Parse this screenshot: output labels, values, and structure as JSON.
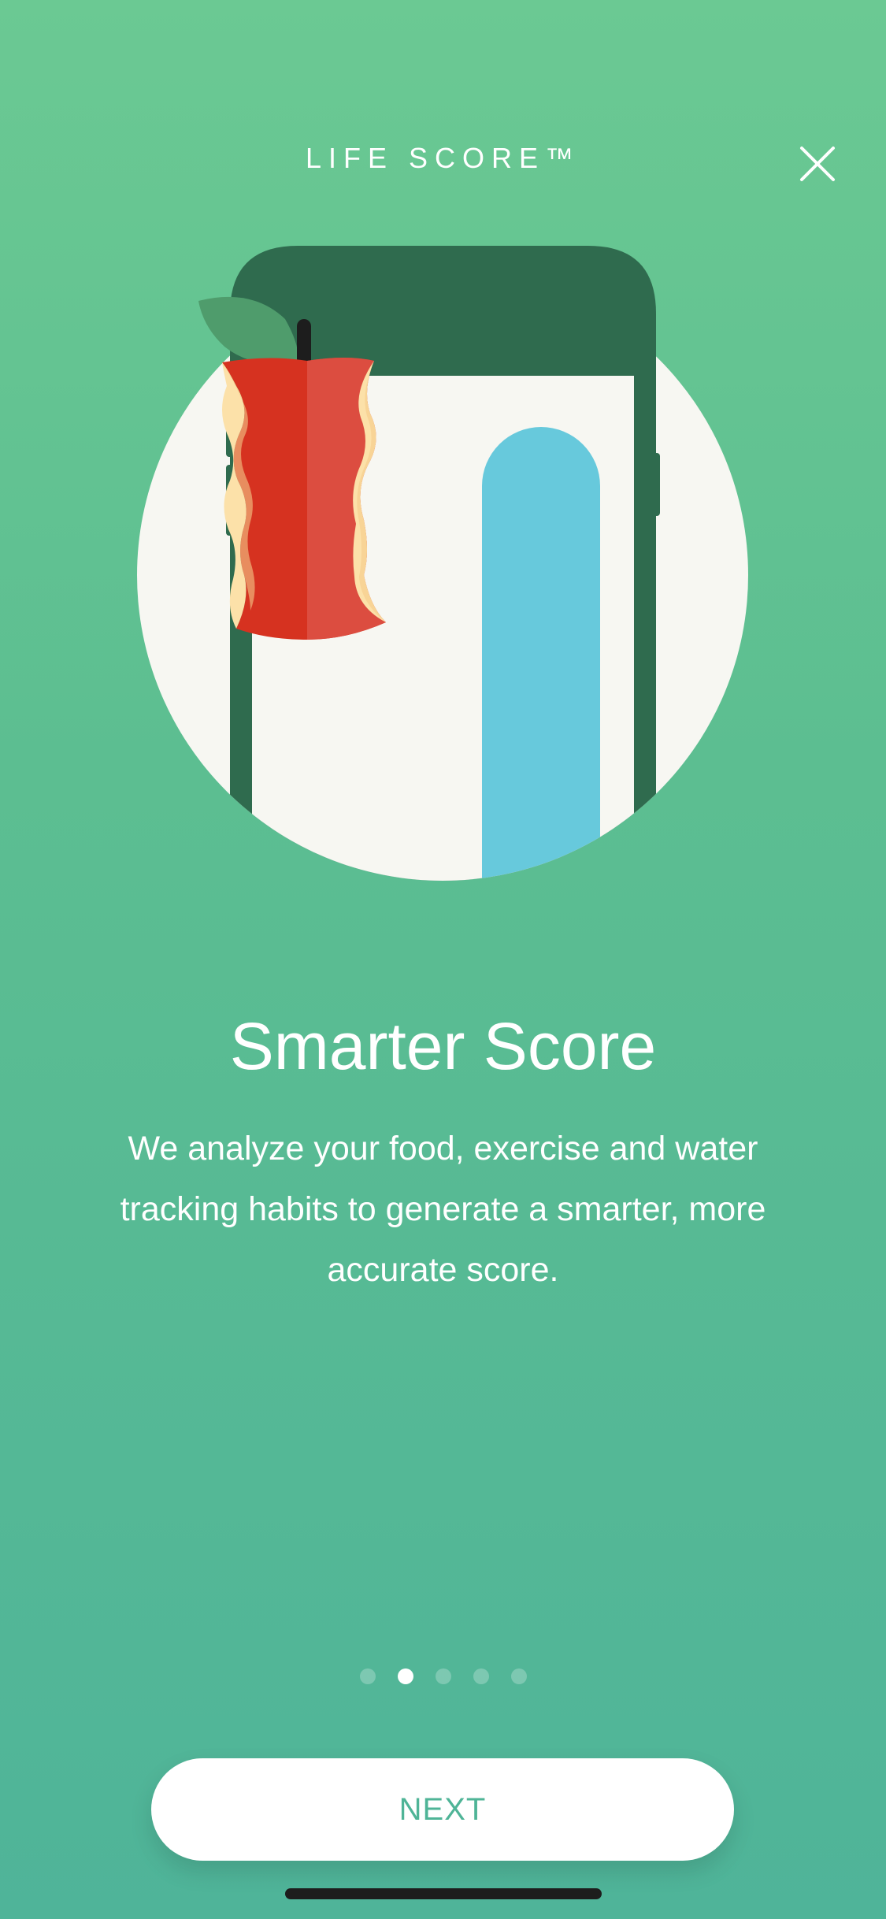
{
  "header": {
    "title": "LIFE SCORE™",
    "close_icon": "close-icon"
  },
  "illustration": {
    "icons": [
      "phone-icon",
      "apple-core-icon",
      "water-level-bar"
    ],
    "colors": {
      "circle": "#f7f7f2",
      "phone_frame": "#2f6b4e",
      "water": "#67c9dc",
      "apple_red": "#d63220",
      "apple_light": "#dc4d40",
      "apple_flesh": "#fce1a9",
      "leaf": "#4f9c6c"
    }
  },
  "content": {
    "title": "Smarter Score",
    "description": "We analyze your food, exercise and water tracking habits to generate a smarter, more accurate score."
  },
  "pager": {
    "count": 5,
    "active_index": 1
  },
  "actions": {
    "next_label": "NEXT"
  },
  "colors": {
    "background_top": "#6bc993",
    "background_bottom": "#4fb499",
    "button_text": "#4fb497"
  }
}
